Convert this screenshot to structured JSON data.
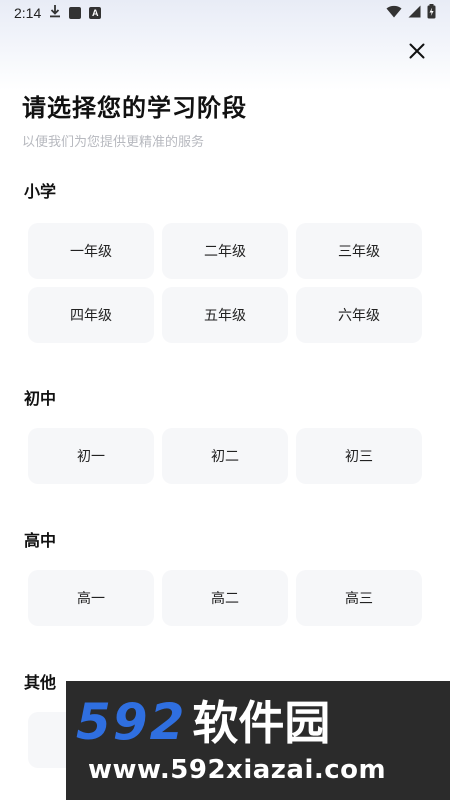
{
  "status_bar": {
    "time": "2:14",
    "a_badge": "A"
  },
  "header": {
    "title": "请选择您的学习阶段",
    "subtitle": "以便我们为您提供更精准的服务"
  },
  "sections": [
    {
      "title": "小学",
      "grades": [
        "一年级",
        "二年级",
        "三年级",
        "四年级",
        "五年级",
        "六年级"
      ]
    },
    {
      "title": "初中",
      "grades": [
        "初一",
        "初二",
        "初三"
      ]
    },
    {
      "title": "高中",
      "grades": [
        "高一",
        "高二",
        "高三"
      ]
    },
    {
      "title": "其他",
      "grades": []
    }
  ],
  "watermark": {
    "brand_num": "592",
    "brand_cn": "软件园",
    "url": "www.592xiazai.com"
  },
  "colors": {
    "chip_bg": "#f6f7f9",
    "brand_blue": "#2f6fe0",
    "subtitle_gray": "#b7b9bf"
  }
}
